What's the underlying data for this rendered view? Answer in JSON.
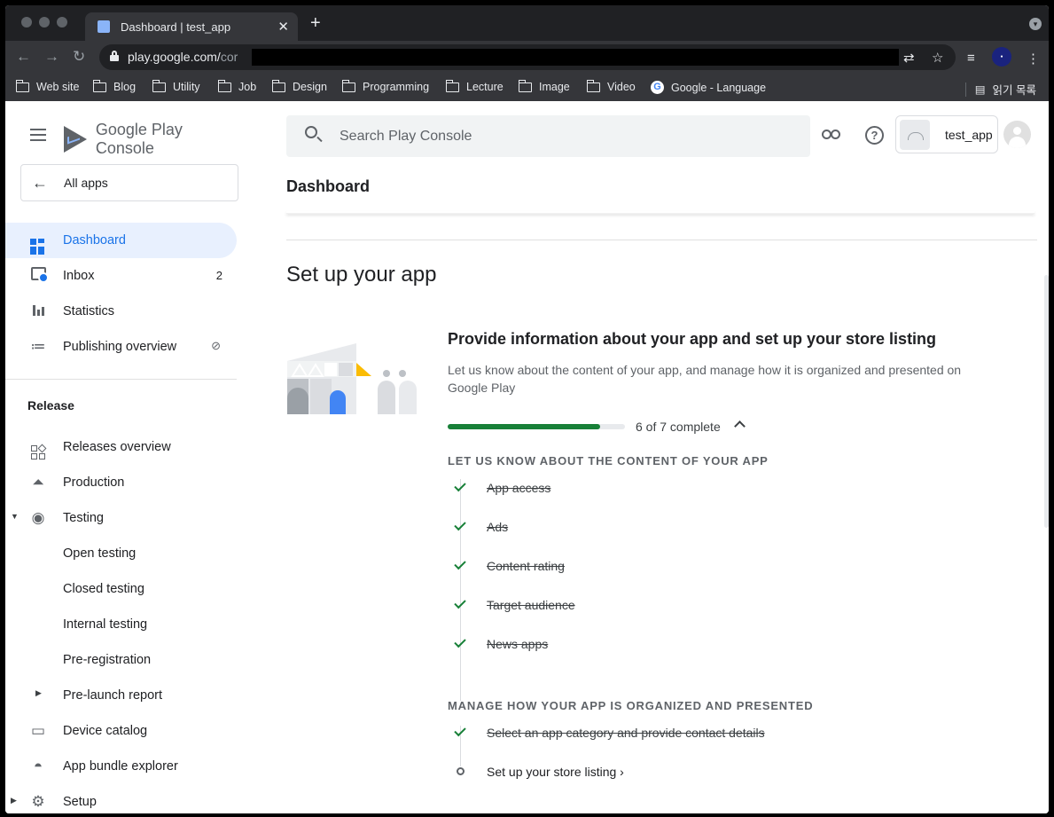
{
  "browser": {
    "tab_title": "Dashboard | test_app",
    "tab_close": "✕",
    "new_tab": "+",
    "url_host": "play.google.com/",
    "url_rest": "cor",
    "bookmarks": [
      "Web site",
      "Blog",
      "Utility",
      "Job",
      "Design",
      "Programming",
      "Lecture",
      "Image",
      "Video"
    ],
    "google_bookmark": "Google - Language",
    "reading_list": "읽기 목록"
  },
  "header": {
    "logo_text": "Google Play",
    "logo_suffix": " Console",
    "search_placeholder": "Search Play Console",
    "app_name": "test_app",
    "page_title": "Dashboard"
  },
  "sidebar": {
    "all_apps": "All apps",
    "items": [
      {
        "label": "Dashboard",
        "icon": "dashboard-icon"
      },
      {
        "label": "Inbox",
        "icon": "inbox-icon",
        "badge": "2"
      },
      {
        "label": "Statistics",
        "icon": "bar-chart-icon"
      },
      {
        "label": "Publishing overview",
        "icon": "publishing-icon"
      }
    ],
    "release_heading": "Release",
    "release_items": [
      {
        "label": "Releases overview",
        "icon": "releases-overview-icon"
      },
      {
        "label": "Production",
        "icon": "production-icon"
      },
      {
        "label": "Testing",
        "icon": "testing-icon"
      },
      {
        "label": "Open testing"
      },
      {
        "label": "Closed testing"
      },
      {
        "label": "Internal testing"
      },
      {
        "label": "Pre-registration"
      },
      {
        "label": "Pre-launch report"
      },
      {
        "label": "Device catalog",
        "icon": "device-catalog-icon"
      },
      {
        "label": "App bundle explorer",
        "icon": "app-bundle-icon"
      },
      {
        "label": "Setup",
        "icon": "gear-icon"
      }
    ]
  },
  "main": {
    "section_title": "Set up your app",
    "card_title": "Provide information about your app and set up your store listing",
    "card_desc": "Let us know about the content of your app, and manage how it is organized and presented on Google Play",
    "progress_fraction": 0.86,
    "progress_label": "6 of 7 complete",
    "group1_heading": "LET US KNOW ABOUT THE CONTENT OF YOUR APP",
    "group1_tasks": [
      "App access",
      "Ads",
      "Content rating",
      "Target audience",
      "News apps"
    ],
    "group2_heading": "MANAGE HOW YOUR APP IS ORGANIZED AND PRESENTED",
    "group2_done": "Select an app category and provide contact details",
    "group2_open": "Set up your store listing ›"
  },
  "colors": {
    "accent": "#1a73e8",
    "active_bg": "#e8f0fe",
    "progress": "#188038"
  }
}
